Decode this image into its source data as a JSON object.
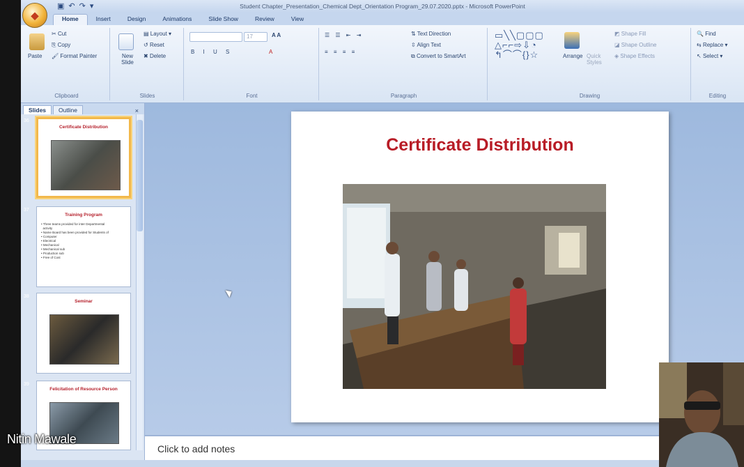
{
  "window": {
    "title": "Student Chapter_Presentation_Chemical Dept_Orientation Program_29.07.2020.pptx - Microsoft PowerPoint",
    "office_button_icon": "office-logo-icon",
    "qat_icons": [
      "save-icon",
      "undo-icon",
      "redo-icon",
      "customize-icon"
    ]
  },
  "ribbon": {
    "tabs": [
      "Home",
      "Insert",
      "Design",
      "Animations",
      "Slide Show",
      "Review",
      "View"
    ],
    "active_tab": "Home",
    "clipboard": {
      "label": "Clipboard",
      "paste": "Paste",
      "cut": "Cut",
      "copy": "Copy",
      "format_painter": "Format Painter"
    },
    "slides": {
      "label": "Slides",
      "new_slide": "New Slide",
      "layout": "Layout",
      "reset": "Reset",
      "delete": "Delete"
    },
    "font": {
      "label": "Font",
      "size": "17"
    },
    "paragraph": {
      "label": "Paragraph",
      "text_direction": "Text Direction",
      "align_text": "Align Text",
      "smartart": "Convert to SmartArt"
    },
    "drawing": {
      "label": "Drawing",
      "arrange": "Arrange",
      "quick_styles": "Quick Styles",
      "shape_fill": "Shape Fill",
      "shape_outline": "Shape Outline",
      "shape_effects": "Shape Effects"
    },
    "editing": {
      "label": "Editing",
      "find": "Find",
      "replace": "Replace",
      "select": "Select"
    }
  },
  "left_pane": {
    "tabs": [
      "Slides",
      "Outline"
    ],
    "slides": [
      {
        "num": "36",
        "title": "Certificate Distribution",
        "kind": "photo",
        "selected": true
      },
      {
        "num": "37",
        "title": "Training Program",
        "kind": "list",
        "selected": false,
        "items": "• Three teams provided for inter Departmental\n  activity\n• Name Board has been provided for Students of\n• Computer\n• Electrical\n• Mechanical\n• Mechanical sub\n• Production sub\n• Free of Cost"
      },
      {
        "num": "38",
        "title": "Seminar",
        "kind": "photo",
        "selected": false
      },
      {
        "num": "39",
        "title": "Felicitation of Resource Person",
        "kind": "photo",
        "selected": false
      }
    ]
  },
  "slide": {
    "title": "Certificate Distribution"
  },
  "notes": {
    "placeholder": "Click to add notes"
  },
  "overlay": {
    "participant_name": "Nitin Mawale"
  }
}
